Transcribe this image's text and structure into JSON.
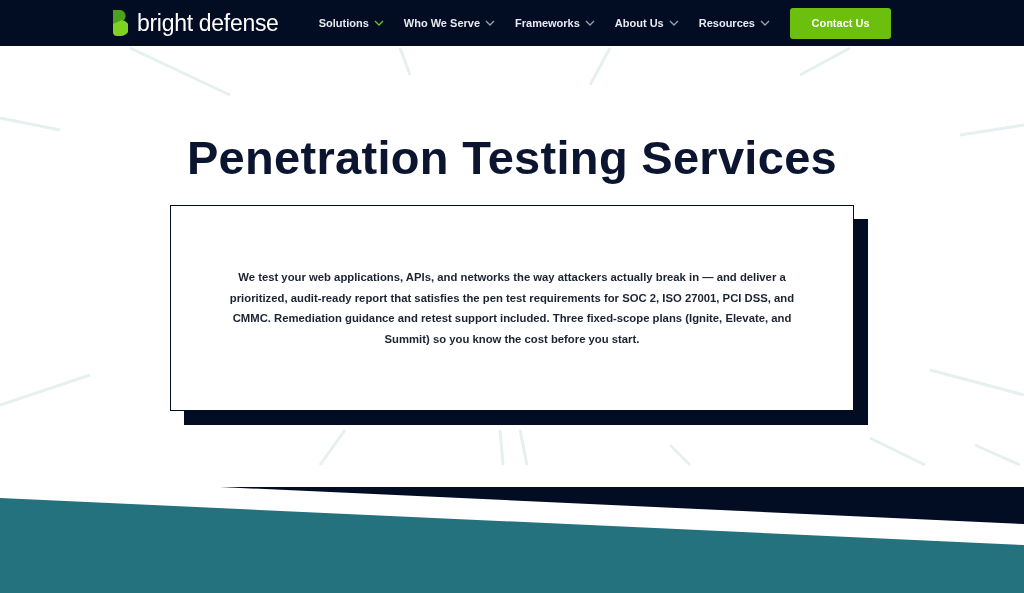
{
  "header": {
    "logo_text": "bright defense",
    "nav": [
      {
        "label": "Solutions",
        "selected": true
      },
      {
        "label": "Who We Serve",
        "selected": false
      },
      {
        "label": "Frameworks",
        "selected": false
      },
      {
        "label": "About Us",
        "selected": false
      },
      {
        "label": "Resources",
        "selected": false
      }
    ],
    "cta": "Contact Us"
  },
  "hero": {
    "title": "Penetration Testing Services",
    "description": "We test your web applications, APIs, and networks the way attackers actually break in — and deliver a prioritized, audit-ready report that satisfies the pen test requirements for SOC 2, ISO 27001, PCI DSS, and CMMC. Remediation guidance and retest support included. Three fixed-scope plans (Ignite, Elevate, and Summit) so you know the cost before you start."
  }
}
